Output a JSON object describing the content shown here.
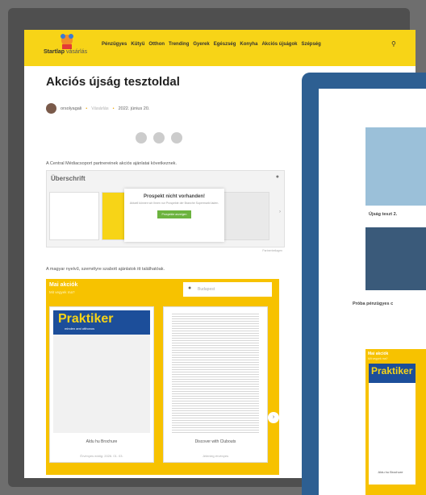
{
  "site": {
    "logo_name": "Startlap",
    "logo_suffix": "vásárlás"
  },
  "nav": [
    "Pénzügyes",
    "Kütyü",
    "Otthon",
    "Trending",
    "Gyerek",
    "Egészség",
    "Konyha",
    "Akciós újságok",
    "Szépség"
  ],
  "article": {
    "title": "Akciós újság tesztoldal",
    "author": "orsolyagali",
    "category": "Vásárlás",
    "date": "2022. június 20.",
    "intro": "A Central Médiacsoport partnereinek akciós ajánlatai következnek.",
    "lang_line": "A magyar nyelvű, személyre szabott ajánlatok itt találhatóak."
  },
  "uberschrift": {
    "heading": "Überschrift",
    "overlay_title": "Prospekt nicht vorhanden!",
    "overlay_text": "Aktuell können wir Ihnen nur Prospekte der Branche Supermarkt laden.",
    "overlay_button": "Prospekte anzeigen",
    "credit": "Partnerbeilagen"
  },
  "mai_akciok": {
    "heading": "Mai akciók",
    "subheading": "Mit vegyek ma?",
    "location_placeholder": "Budapest",
    "brochures": [
      {
        "brand": "Praktiker",
        "brand_sub": "minden ami otthonos",
        "title": "Aldu hu Brochure",
        "validity": "Érvényes eddig: 2026. 01. 03."
      },
      {
        "title": "Discover with Clubouts",
        "validity": "Jelenleg érvényes"
      }
    ]
  },
  "overlay": {
    "card1_label": "Újság teszt 2.",
    "card2_label": "Próba pénzügyes c",
    "mini_heading": "Mai akciók",
    "mini_sub": "Mit vegyek ma?",
    "mini_brand": "Praktiker",
    "mini_title": "Aldu hu Brochure"
  }
}
